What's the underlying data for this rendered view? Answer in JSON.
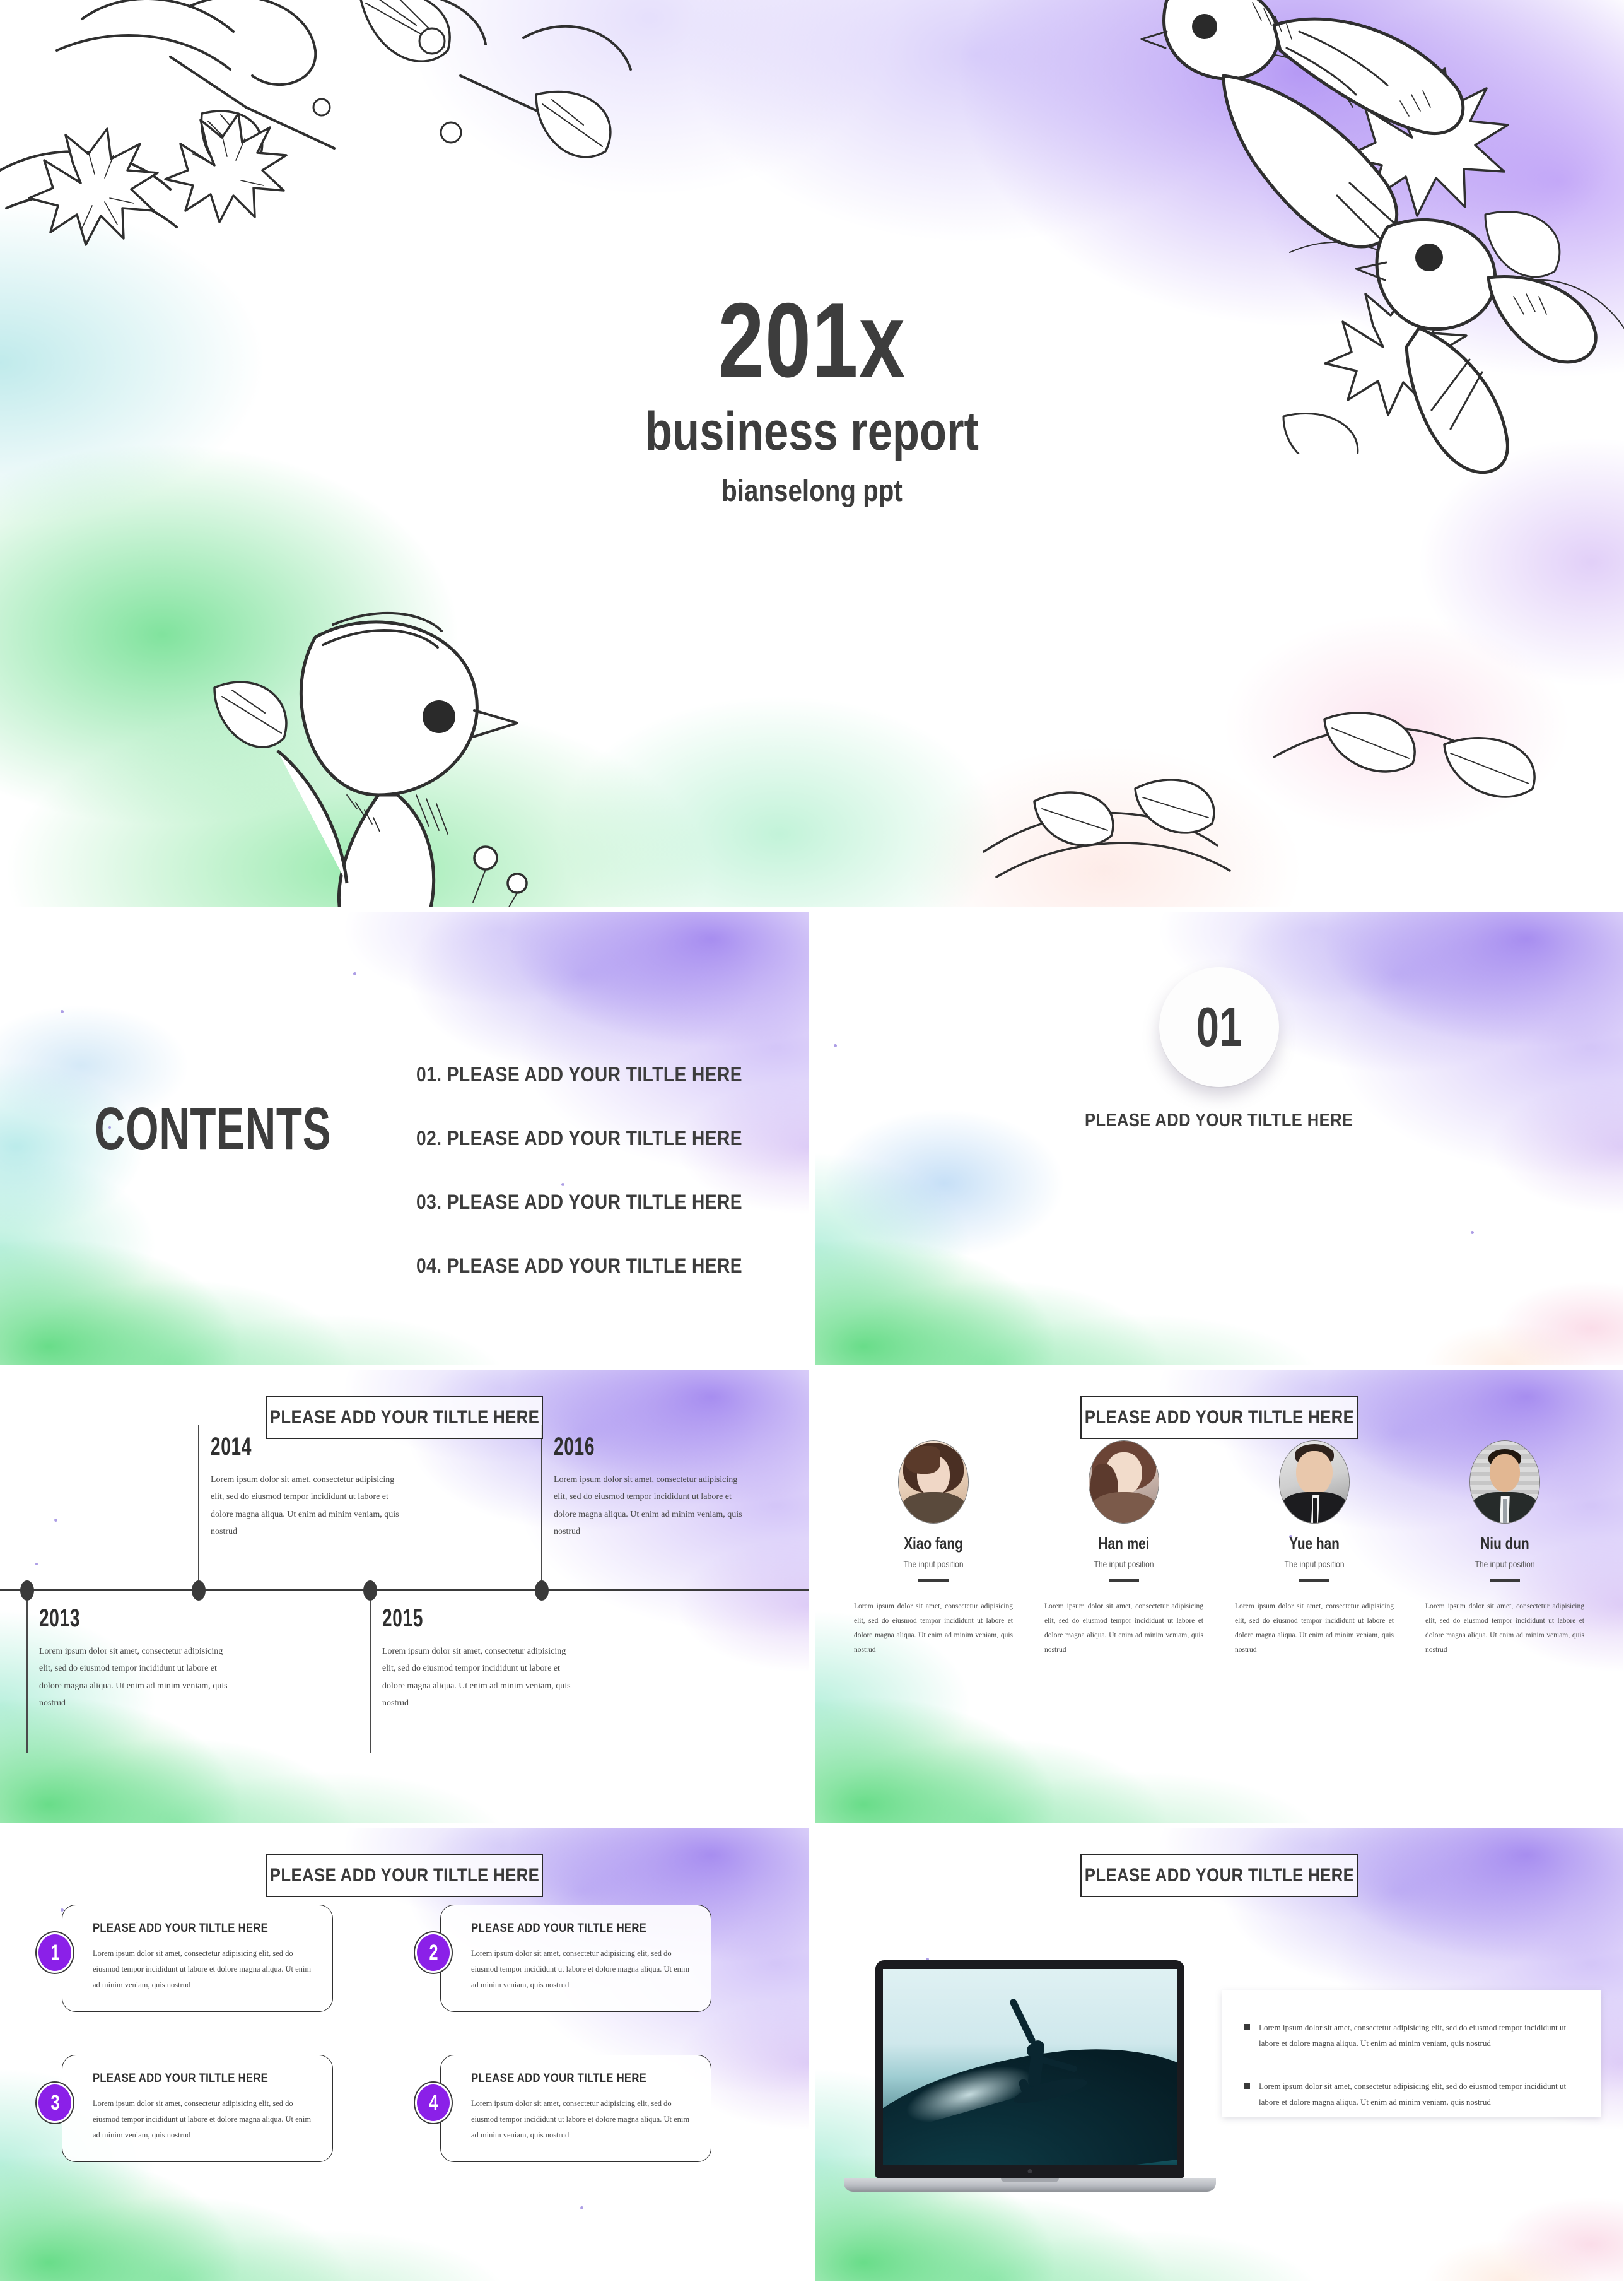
{
  "deck": {
    "accent_purple": "#8b20e8",
    "ink": "#3d3d3d"
  },
  "title_slide": {
    "year": "201x",
    "headline": "business report",
    "subtitle": "bianselong ppt"
  },
  "contents_slide": {
    "heading": "CONTENTS",
    "items": [
      "01. PLEASE ADD YOUR TILTLE HERE",
      "02. PLEASE ADD YOUR TILTLE HERE",
      "03. PLEASE ADD YOUR TILTLE HERE",
      "04. PLEASE ADD YOUR TILTLE HERE"
    ]
  },
  "section_slide": {
    "number": "01",
    "caption": "PLEASE ADD YOUR TILTLE HERE"
  },
  "timeline_slide": {
    "title": "PLEASE ADD YOUR TILTLE HERE",
    "entries": [
      {
        "year": "2013",
        "text": "Lorem ipsum dolor sit amet, consectetur adipisicing elit, sed do eiusmod tempor incididunt ut labore et dolore magna aliqua. Ut enim ad minim veniam, quis nostrud"
      },
      {
        "year": "2014",
        "text": "Lorem ipsum dolor sit amet, consectetur adipisicing elit, sed do eiusmod tempor incididunt ut labore et dolore magna aliqua. Ut enim ad minim veniam, quis nostrud"
      },
      {
        "year": "2015",
        "text": "Lorem ipsum dolor sit amet, consectetur adipisicing elit, sed do eiusmod tempor incididunt ut labore et dolore magna aliqua. Ut enim ad minim veniam, quis nostrud"
      },
      {
        "year": "2016",
        "text": "Lorem ipsum dolor sit amet, consectetur adipisicing elit, sed do eiusmod tempor incididunt ut labore et dolore magna aliqua. Ut enim ad minim veniam, quis nostrud"
      }
    ]
  },
  "team_slide": {
    "title": "PLEASE ADD YOUR TILTLE HERE",
    "members": [
      {
        "name": "Xiao fang",
        "position": "The input position",
        "bio": "Lorem ipsum dolor sit amet, consectetur adipisicing elit, sed do eiusmod tempor incididunt ut labore et dolore magna aliqua. Ut enim ad minim veniam, quis nostrud"
      },
      {
        "name": "Han mei",
        "position": "The input position",
        "bio": "Lorem ipsum dolor sit amet, consectetur adipisicing elit, sed do eiusmod tempor incididunt ut labore et dolore magna aliqua. Ut enim ad minim veniam, quis nostrud"
      },
      {
        "name": "Yue han",
        "position": "The input position",
        "bio": "Lorem ipsum dolor sit amet, consectetur adipisicing elit, sed do eiusmod tempor incididunt ut labore et dolore magna aliqua. Ut enim ad minim veniam, quis nostrud"
      },
      {
        "name": "Niu dun",
        "position": "The input position",
        "bio": "Lorem ipsum dolor sit amet, consectetur adipisicing elit, sed do eiusmod tempor incididunt ut labore et dolore magna aliqua. Ut enim ad minim veniam, quis nostrud"
      }
    ]
  },
  "cards_slide": {
    "title": "PLEASE ADD YOUR TILTLE HERE",
    "cards": [
      {
        "number": "1",
        "title": "PLEASE ADD YOUR TILTLE HERE",
        "text": "Lorem ipsum dolor sit amet, consectetur adipisicing elit, sed do eiusmod tempor incididunt ut labore et dolore magna aliqua. Ut enim ad minim veniam, quis nostrud"
      },
      {
        "number": "2",
        "title": "PLEASE ADD YOUR TILTLE HERE",
        "text": "Lorem ipsum dolor sit amet, consectetur adipisicing elit, sed do eiusmod tempor incididunt ut labore et dolore magna aliqua. Ut enim ad minim veniam, quis nostrud"
      },
      {
        "number": "3",
        "title": "PLEASE ADD YOUR TILTLE HERE",
        "text": "Lorem ipsum dolor sit amet, consectetur adipisicing elit, sed do eiusmod tempor incididunt ut labore et dolore magna aliqua. Ut enim ad minim veniam, quis nostrud"
      },
      {
        "number": "4",
        "title": "PLEASE ADD YOUR TILTLE HERE",
        "text": "Lorem ipsum dolor sit amet, consectetur adipisicing elit, sed do eiusmod tempor incididunt ut labore et dolore magna aliqua. Ut enim ad minim veniam, quis nostrud"
      }
    ]
  },
  "device_slide": {
    "title": "PLEASE ADD YOUR TILTLE HERE",
    "bullets": [
      "Lorem ipsum dolor sit amet, consectetur adipisicing elit, sed do eiusmod tempor incididunt ut labore et dolore magna aliqua. Ut enim ad minim veniam, quis nostrud",
      "Lorem ipsum dolor sit amet, consectetur adipisicing elit, sed do eiusmod tempor incididunt ut labore et dolore magna aliqua. Ut enim ad minim veniam, quis nostrud"
    ]
  }
}
